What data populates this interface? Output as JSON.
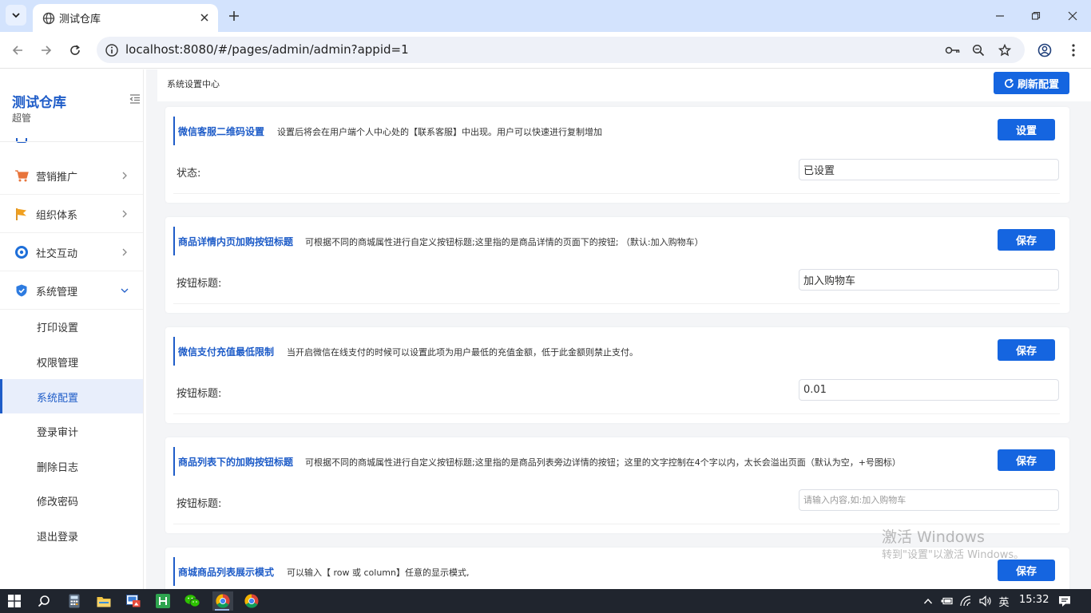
{
  "browser": {
    "tab_title": "测试仓库",
    "url": "localhost:8080/#/pages/admin/admin?appid=1"
  },
  "sidebar": {
    "brand": "测试仓库",
    "role": "超管",
    "menu": [
      {
        "label": "营销推广",
        "icon": "cart-icon",
        "color": "#e8743b"
      },
      {
        "label": "组织体系",
        "icon": "flag-icon",
        "color": "#f0a020"
      },
      {
        "label": "社交互动",
        "icon": "share-icon",
        "color": "#1e6fd9"
      },
      {
        "label": "系统管理",
        "icon": "shield-icon",
        "color": "#2d7be0"
      }
    ],
    "submenu": [
      "打印设置",
      "权限管理",
      "系统配置",
      "登录审计",
      "删除日志",
      "修改密码",
      "退出登录"
    ],
    "active_sub": "系统配置"
  },
  "main": {
    "title": "系统设置中心",
    "refresh_label": "刷新配置",
    "cards": [
      {
        "title": "微信客服二维码设置",
        "desc": "设置后将会在用户端个人中心处的【联系客服】中出现。用户可以快速进行复制增加",
        "button": "设置",
        "label": "状态:",
        "value": "已设置",
        "placeholder": ""
      },
      {
        "title": "商品详情内页加购按钮标题",
        "desc": "可根据不同的商城属性进行自定义按钮标题;这里指的是商品详情的页面下的按钮; （默认:加入购物车）",
        "button": "保存",
        "label": "按钮标题:",
        "value": "加入购物车",
        "placeholder": ""
      },
      {
        "title": "微信支付充值最低限制",
        "desc": "当开启微信在线支付的时候可以设置此项为用户最低的充值金额，低于此金额则禁止支付。",
        "button": "保存",
        "label": "按钮标题:",
        "value": "0.01",
        "placeholder": ""
      },
      {
        "title": "商品列表下的加购按钮标题",
        "desc": "可根据不同的商城属性进行自定义按钮标题;这里指的是商品列表旁边详情的按钮；这里的文字控制在4个字以内，太长会溢出页面（默认为空，+号图标）",
        "button": "保存",
        "label": "按钮标题:",
        "value": "",
        "placeholder": "请输入内容,如:加入购物车"
      },
      {
        "title": "商城商品列表展示模式",
        "desc": "可以输入【 row 或 column】任意的显示模式,",
        "button": "保存",
        "label": "",
        "value": "",
        "placeholder": ""
      }
    ]
  },
  "watermark": {
    "line1": "激活 Windows",
    "line2": "转到\"设置\"以激活 Windows。"
  },
  "taskbar": {
    "ime": "英",
    "time": "15:32"
  },
  "colors": {
    "accent": "#1565e0",
    "brand": "#1e5cc8",
    "tabstrip": "#d3e3fd",
    "taskbar": "#20252e"
  }
}
